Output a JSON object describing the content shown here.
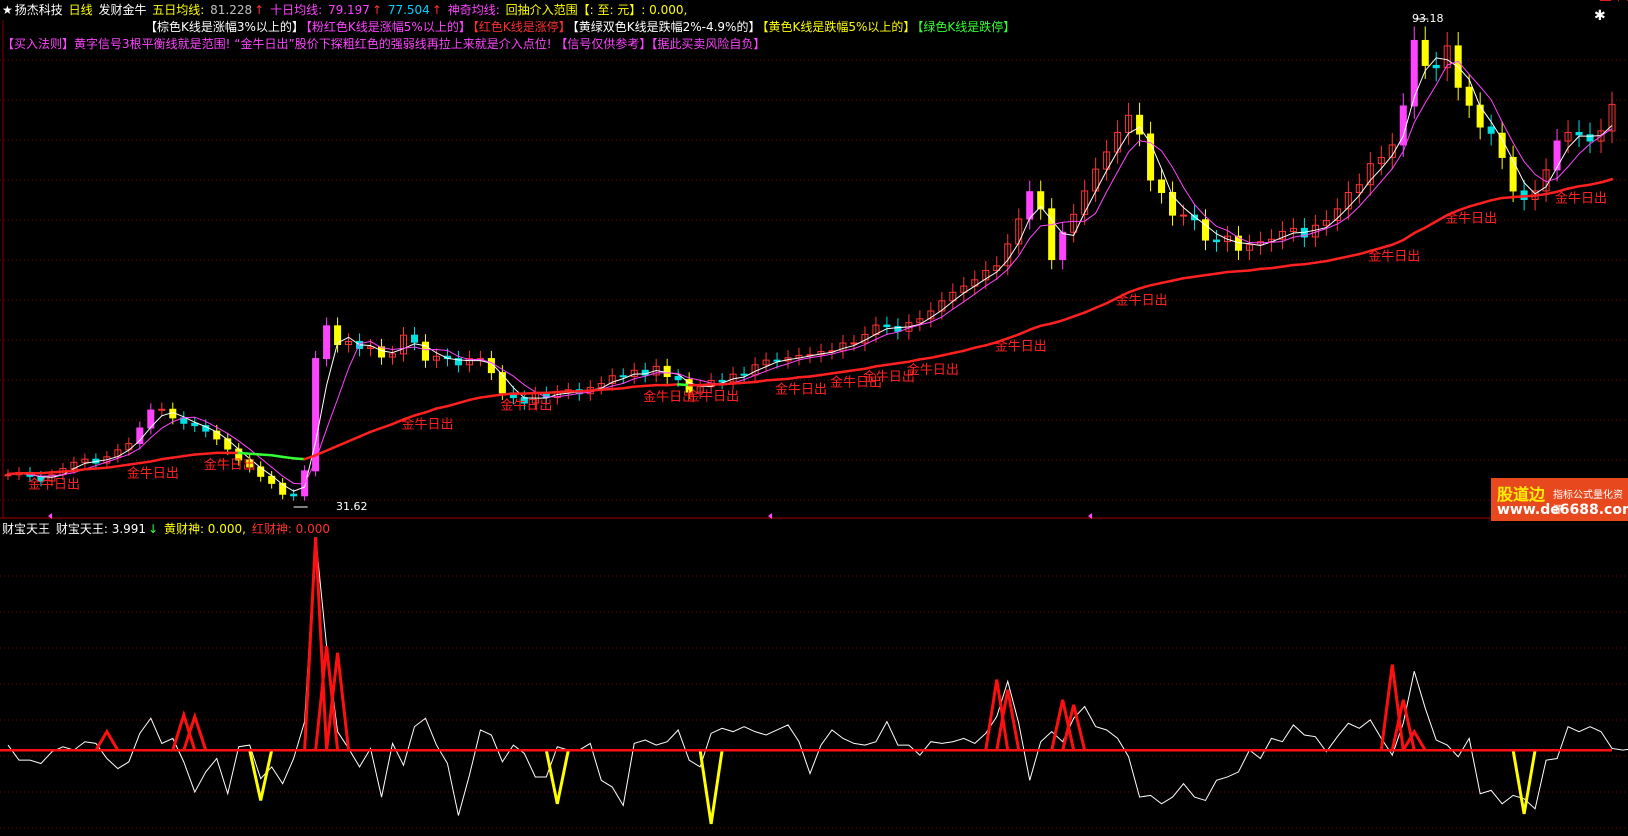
{
  "header": {
    "stock_name": "扬杰科技",
    "period": "日线",
    "indicator_name": "发财金牛",
    "ma5_label": "五日均线:",
    "ma5_value": "81.228",
    "ma10_label": "十日均线:",
    "ma10_value": "79.197",
    "ma_extra_value": "77.504",
    "magic_label": "神奇均线:",
    "pullback_label": "回抽介入范围【: 至: 元】: 0.000,",
    "arrow_up": "↑",
    "arrow_down": "↓"
  },
  "legend_line": [
    {
      "text": "【棕色K线是涨幅3%以上的】",
      "color": "#ffffff"
    },
    {
      "text": "【粉红色K线是涨幅5%以上的】",
      "color": "#ff44ff"
    },
    {
      "text": "【红色K线是涨停】",
      "color": "#ff3030"
    },
    {
      "text": "【黄绿双色K线是跌幅2%-4.9%的】",
      "color": "#ffffff"
    },
    {
      "text": "【黄色K线是跌幅5%以上的】",
      "color": "#ffff00"
    },
    {
      "text": "【绿色K线是跌停】",
      "color": "#33ff33"
    }
  ],
  "notice_line": "【买入法则】黄字信号3根平衡线就是范围! “金牛日出”股价下探粗红色的强弱线再拉上来就是介入点位! 【信号仅供参考】【据此买卖风险自负】",
  "signal_label": "金牛日出",
  "price_high_label": "93.18",
  "price_low_label": "31.62",
  "subchart": {
    "title": "财宝天王",
    "value_label": "财宝天王: 3.991",
    "yellow_label": "黄财神: 0.000,",
    "red_label": "红财神: 0.000"
  },
  "watermark": {
    "brand": "股道边",
    "tagline": "指标公式量化资源",
    "url": "www.de6688.com"
  },
  "close_glyph": "✱",
  "colors": {
    "up_candle": "#ff3333",
    "down_candle": "#00e0e0",
    "strong_up": "#ff44ff",
    "drop": "#ffff00",
    "ma_red": "#ff2020",
    "ma_green": "#33ff33",
    "ma5": "#ffffff",
    "ma10": "#ff44ff",
    "sub_line": "#ffffff",
    "sub_red": "#ff1010",
    "sub_yellow": "#ffff00",
    "grid": "#800000"
  },
  "chart_data": {
    "type": "candlestick",
    "price_range": [
      31.62,
      93.18
    ],
    "close": [
      34.6,
      34.9,
      34.4,
      33.8,
      34.6,
      35.4,
      36.2,
      36.6,
      36.1,
      36.9,
      37.8,
      38.6,
      40.6,
      42.9,
      43.0,
      41.9,
      41.2,
      40.9,
      40.2,
      39.2,
      37.9,
      36.5,
      35.6,
      34.4,
      33.5,
      32.1,
      31.9,
      35.1,
      49.5,
      53.7,
      51.3,
      51.7,
      50.8,
      51.0,
      49.7,
      50.1,
      52.5,
      51.6,
      49.3,
      49.8,
      49.5,
      48.7,
      49.5,
      49.5,
      47.7,
      45.1,
      44.5,
      43.8,
      45.0,
      44.5,
      45.2,
      45.5,
      45.0,
      45.8,
      46.3,
      47.3,
      47.2,
      48.0,
      47.4,
      48.5,
      47.2,
      46.8,
      45.2,
      45.9,
      46.7,
      46.5,
      47.5,
      47.4,
      48.7,
      49.3,
      49.2,
      49.6,
      49.9,
      50.0,
      50.4,
      50.5,
      51.5,
      51.5,
      52.6,
      53.8,
      53.6,
      53.0,
      54.1,
      54.6,
      55.6,
      56.9,
      58.0,
      58.8,
      59.6,
      60.8,
      61.4,
      64.2,
      67.4,
      70.9,
      68.7,
      62.2,
      65.7,
      68.0,
      71.0,
      73.8,
      76.0,
      78.5,
      80.7,
      78.3,
      72.4,
      70.8,
      67.9,
      67.9,
      67.3,
      64.7,
      64.5,
      65.2,
      63.4,
      64.1,
      64.5,
      64.8,
      65.8,
      66.2,
      65.1,
      66.6,
      67.2,
      68.7,
      70.8,
      71.8,
      74.5,
      75.3,
      76.9,
      81.9,
      90.3,
      87.1,
      86.8,
      89.6,
      84.3,
      82.0,
      79.2,
      78.4,
      75.3,
      71.0,
      69.9,
      71.0,
      73.7,
      77.4,
      78.5,
      78.2,
      77.4,
      78.7,
      82.1
    ],
    "ma_thick": [
      34.7,
      34.8,
      34.8,
      34.8,
      34.9,
      35.0,
      35.1,
      35.3,
      35.4,
      35.5,
      35.7,
      35.9,
      36.1,
      36.3,
      36.6,
      36.8,
      37.0,
      37.2,
      37.3,
      37.4,
      37.4,
      37.4,
      37.3,
      37.2,
      37.1,
      36.9,
      36.7,
      36.6,
      37.1,
      37.7,
      38.3,
      38.9,
      39.5,
      40.1,
      40.6,
      41.1,
      41.7,
      42.2,
      42.6,
      43.1,
      43.4,
      43.8,
      44.2,
      44.5,
      44.7,
      44.9,
      45.0,
      45.0,
      45.1,
      45.1,
      45.2,
      45.3,
      45.3,
      45.4,
      45.5,
      45.6,
      45.7,
      45.9,
      46.0,
      46.1,
      46.1,
      46.2,
      46.1,
      46.1,
      46.2,
      46.2,
      46.3,
      46.4,
      46.5,
      46.7,
      46.8,
      46.9,
      47.1,
      47.2,
      47.4,
      47.6,
      47.8,
      48.0,
      48.2,
      48.5,
      48.7,
      48.9,
      49.1,
      49.4,
      49.6,
      49.9,
      50.2,
      50.5,
      50.9,
      51.2,
      51.6,
      52.1,
      52.6,
      53.2,
      53.7,
      54.0,
      54.4,
      54.9,
      55.4,
      56.0,
      56.6,
      57.3,
      58.0,
      58.5,
      58.9,
      59.2,
      59.5,
      59.8,
      60.0,
      60.2,
      60.4,
      60.6,
      60.7,
      60.8,
      61.0,
      61.1,
      61.3,
      61.5,
      61.6,
      61.8,
      62.0,
      62.3,
      62.6,
      62.9,
      63.3,
      63.7,
      64.1,
      64.7,
      65.6,
      66.3,
      67.1,
      67.9,
      68.5,
      69.0,
      69.4,
      69.8,
      70.1,
      70.2,
      70.3,
      70.4,
      70.6,
      70.9,
      71.3,
      71.6,
      71.8,
      72.1,
      72.5
    ],
    "signal_indices": [
      4,
      13,
      20,
      38,
      47,
      60,
      64,
      72,
      77,
      80,
      84,
      92,
      103,
      126,
      133,
      143,
      147
    ],
    "sub_line": [
      4.3,
      3.4,
      3.4,
      3.2,
      3.9,
      4.2,
      4.0,
      4.5,
      4.4,
      3.5,
      2.9,
      3.3,
      5.0,
      5.9,
      4.4,
      4.7,
      3.3,
      1.5,
      2.7,
      3.5,
      1.4,
      4.2,
      4.3,
      2.3,
      3.0,
      2.0,
      3.5,
      5.7,
      16.7,
      10.2,
      5.1,
      4.1,
      3.0,
      4.1,
      1.2,
      4.4,
      3.1,
      5.4,
      5.9,
      4.3,
      3.2,
      0.1,
      2.5,
      5.2,
      4.9,
      3.3,
      4.3,
      3.8,
      2.4,
      2.4,
      4.2,
      4.0,
      4.0,
      4.4,
      2.2,
      1.8,
      0.7,
      4.4,
      4.6,
      4.3,
      4.5,
      5.2,
      3.4,
      3.0,
      5.0,
      5.3,
      5.1,
      5.4,
      5.1,
      4.9,
      5.2,
      5.5,
      4.5,
      2.6,
      4.3,
      5.2,
      4.7,
      4.4,
      4.3,
      4.5,
      5.7,
      4.3,
      4.3,
      3.7,
      4.5,
      4.4,
      4.5,
      4.7,
      4.4,
      5.0,
      6.0,
      8.1,
      5.6,
      2.2,
      4.5,
      5.1,
      4.5,
      5.9,
      6.6,
      5.4,
      5.2,
      4.7,
      3.6,
      1.2,
      1.3,
      0.8,
      1.2,
      2.0,
      1.2,
      1.0,
      2.2,
      2.4,
      2.7,
      4.0,
      3.5,
      4.7,
      4.5,
      5.5,
      4.9,
      4.8,
      3.9,
      4.8,
      5.6,
      5.3,
      5.8,
      4.7,
      3.7,
      5.6,
      8.7,
      6.5,
      4.6,
      4.3,
      3.6,
      4.7,
      1.4,
      1.6,
      0.8,
      1.3,
      1.1,
      0.5,
      3.4,
      3.5,
      5.4,
      5.1,
      5.4,
      5.1,
      4.1,
      4.0,
      4.1
    ],
    "sub_red_peaks": [
      {
        "i": 9,
        "v": 5.1
      },
      {
        "i": 16,
        "v": 6.1
      },
      {
        "i": 17,
        "v": 6.0
      },
      {
        "i": 28,
        "v": 16.7
      },
      {
        "i": 29,
        "v": 10.2
      },
      {
        "i": 30,
        "v": 9.8
      },
      {
        "i": 90,
        "v": 8.2
      },
      {
        "i": 91,
        "v": 7.6
      },
      {
        "i": 96,
        "v": 7.0
      },
      {
        "i": 97,
        "v": 6.7
      },
      {
        "i": 126,
        "v": 9.1
      },
      {
        "i": 127,
        "v": 7.0
      },
      {
        "i": 128,
        "v": 5.1
      }
    ],
    "sub_yellow_dips": [
      {
        "i": 23,
        "v": 1.0
      },
      {
        "i": 50,
        "v": 0.8
      },
      {
        "i": 64,
        "v": -0.4
      },
      {
        "i": 138,
        "v": 0.2
      }
    ],
    "sub_range": [
      -1,
      17
    ],
    "sub_zero_level": 3.991
  }
}
